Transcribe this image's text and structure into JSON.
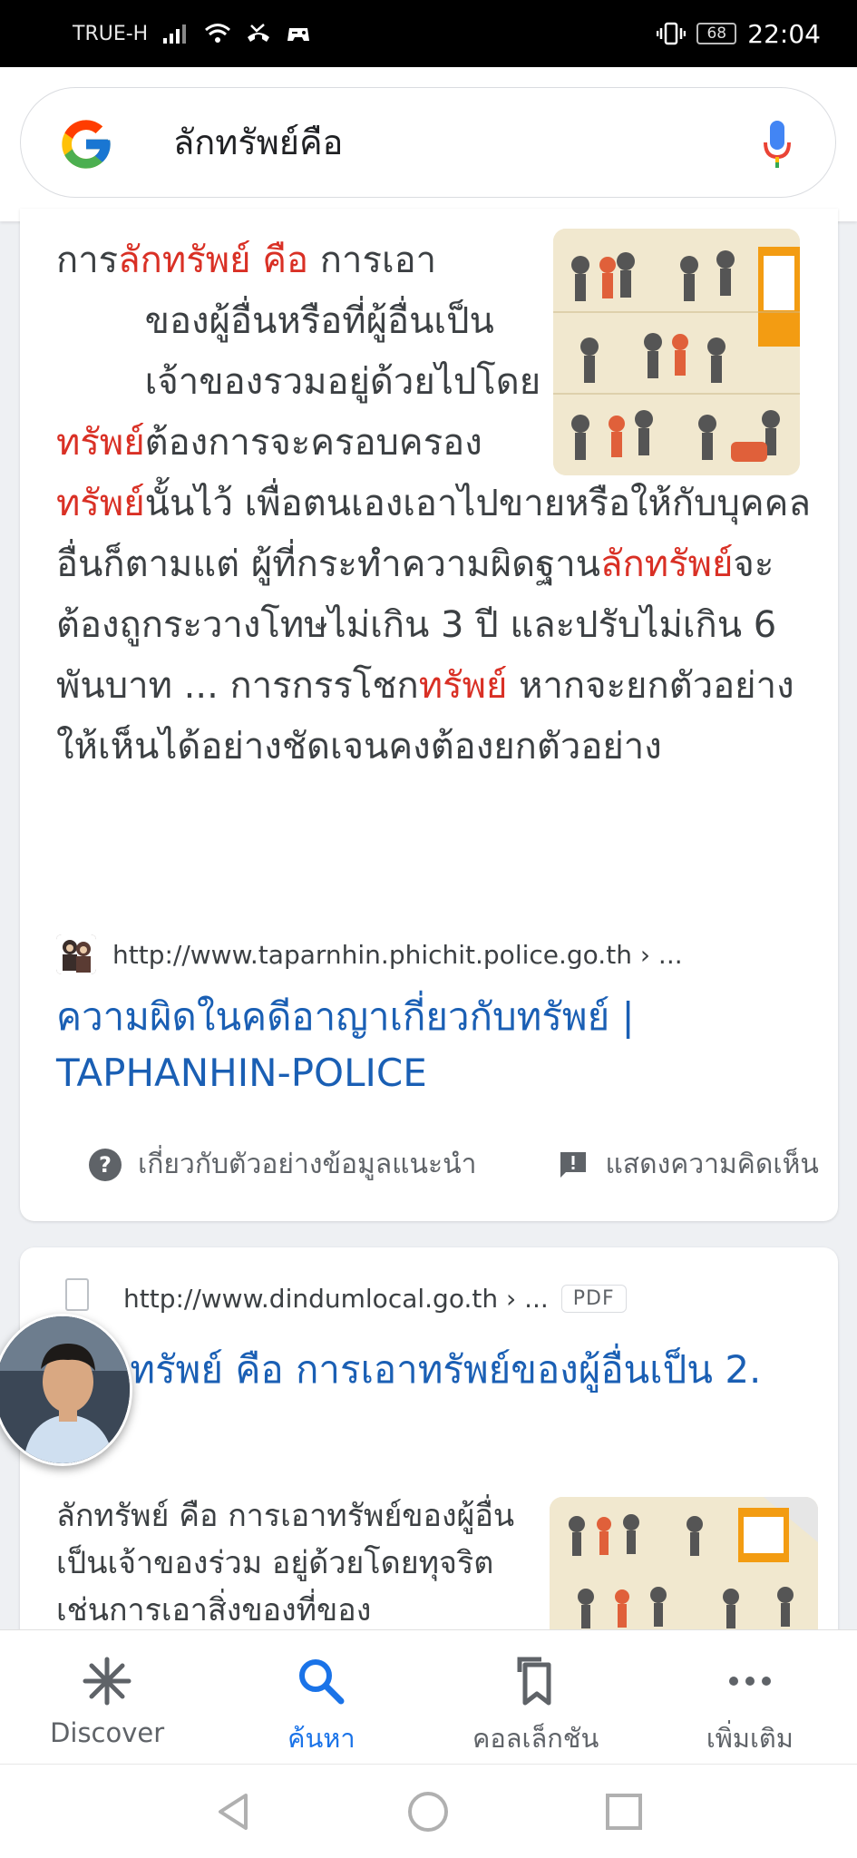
{
  "status_bar": {
    "carrier": "TRUE-H",
    "battery": "68",
    "time": "22:04"
  },
  "search": {
    "query": "ลักทรัพย์คือ"
  },
  "result1": {
    "snippet_parts": [
      {
        "text": "การ",
        "hl": false
      },
      {
        "text": "ลักทรัพย์ คือ",
        "hl": true
      },
      {
        "text": " การเอา",
        "hl": false
      },
      {
        "text": "ทรัพย์",
        "hl": true
      },
      {
        "text": "ของผู้อื่นหรือที่ผู้อื่นเป็นเจ้าของรวมอยู่ด้วยไปโดยต้องการจะครอบครอง",
        "hl": false
      },
      {
        "text": "ทรัพย์",
        "hl": true
      },
      {
        "text": "นั้นไว้ เพื่อตนเองเอาไปขายหรือให้กับบุคคลอื่นก็ตามแต่ ผู้ที่กระทำความผิดฐาน",
        "hl": false
      },
      {
        "text": "ลักทรัพย์",
        "hl": true
      },
      {
        "text": "จะต้องถูกระวางโทษไม่เกิน 3 ปี และปรับไม่เกิน 6 พันบาท ... การกรรโชก",
        "hl": false
      },
      {
        "text": "ทรัพย์",
        "hl": true
      },
      {
        "text": " หากจะยกตัวอย่างให้เห็นได้อย่างชัดเจนคงต้องยกตัวอย่าง",
        "hl": false
      }
    ],
    "source_url": "http://www.taparnhin.phichit.police.go.th › ...",
    "title": "ความผิดในคดีอาญาเกี่ยวกับทรัพย์ | TAPHANHIN-POLICE",
    "about_label": "เกี่ยวกับตัวอย่างข้อมูลแนะนำ",
    "feedback_label": "แสดงความคิดเห็น"
  },
  "result2": {
    "source_url": "http://www.dindumlocal.go.th › ...",
    "badge": "PDF",
    "title": "ักทรัพย์ คือ การเอาทรัพย์ของผู้อื่นเป็น 2.",
    "snippet": "ลักทรัพย์ คือ การเอาทรัพย์ของผู้อื่นเป็นเจ้าของร่วม อยู่ด้วยโดยทุจริต เช่นการเอาสิ่งของที่ของ"
  },
  "bottom_nav": {
    "items": [
      {
        "label": "Discover",
        "icon": "asterisk-icon",
        "active": false
      },
      {
        "label": "ค้นหา",
        "icon": "search-icon",
        "active": true
      },
      {
        "label": "คอลเล็กชัน",
        "icon": "bookmarks-icon",
        "active": false
      },
      {
        "label": "เพิ่มเติม",
        "icon": "more-horiz-icon",
        "active": false
      }
    ]
  },
  "colors": {
    "highlight": "#d93025",
    "link": "#1a5fb4",
    "active": "#1a73e8"
  }
}
